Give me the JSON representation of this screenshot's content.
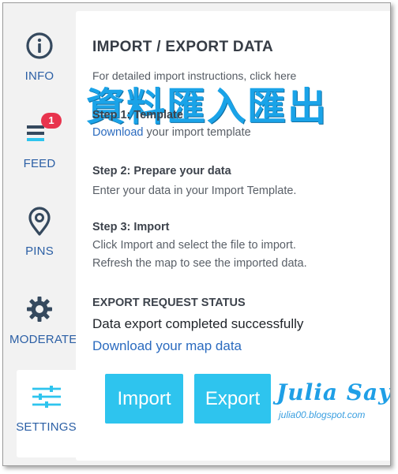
{
  "sidebar": {
    "items": [
      {
        "label": "INFO",
        "icon": "info-icon"
      },
      {
        "label": "FEED",
        "icon": "feed-icon",
        "badge": "1"
      },
      {
        "label": "PINS",
        "icon": "map-pin-icon"
      },
      {
        "label": "MODERATE",
        "icon": "gear-icon"
      },
      {
        "label": "SETTINGS",
        "icon": "sliders-icon",
        "active": true
      }
    ]
  },
  "panel": {
    "title": "IMPORT / EXPORT DATA",
    "instructions": "For detailed import instructions, click here",
    "overlay_text": "資料匯入匯出",
    "steps": [
      {
        "title": "Step 1: Template",
        "link": "Download",
        "text": " your import template"
      },
      {
        "title": "Step 2: Prepare your data",
        "text": "Enter your data in your Import Template."
      },
      {
        "title": "Step 3: Import",
        "text": "Click Import and select the file to import.",
        "text2": "Refresh the map to see the imported data."
      }
    ],
    "export": {
      "heading": "EXPORT REQUEST STATUS",
      "status": "Data export completed successfully",
      "link": "Download your map data"
    },
    "buttons": {
      "import": "Import",
      "export": "Export"
    },
    "watermark": {
      "title": "Julia Says",
      "subtitle": "julia00.blogspot.com"
    }
  },
  "colors": {
    "accent": "#2ec4ee",
    "nav_text": "#2b5fa5",
    "badge": "#e8344e",
    "link": "#2b6bbf",
    "overlay": "#1aa3e8"
  }
}
